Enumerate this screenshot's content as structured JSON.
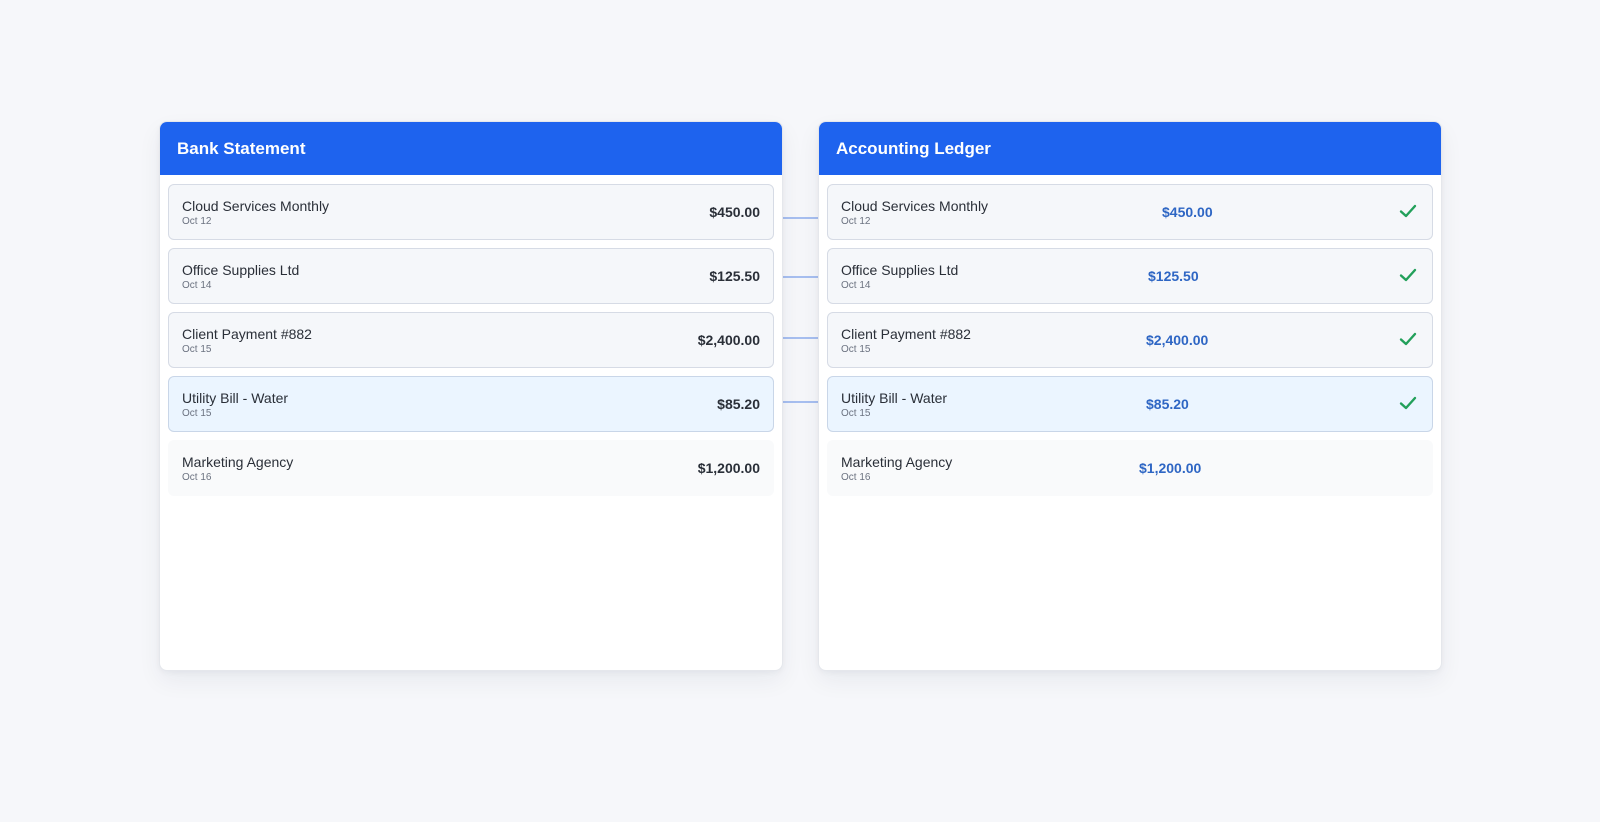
{
  "bank": {
    "title": "Bank Statement",
    "rows": [
      {
        "name": "Cloud Services Monthly",
        "date": "Oct 12",
        "amount": "$450.00"
      },
      {
        "name": "Office Supplies Ltd",
        "date": "Oct 14",
        "amount": "$125.50"
      },
      {
        "name": "Client Payment #882",
        "date": "Oct 15",
        "amount": "$2,400.00"
      },
      {
        "name": "Utility Bill - Water",
        "date": "Oct 15",
        "amount": "$85.20"
      },
      {
        "name": "Marketing Agency",
        "date": "Oct 16",
        "amount": "$1,200.00"
      }
    ]
  },
  "ledger": {
    "title": "Accounting Ledger",
    "rows": [
      {
        "name": "Cloud Services Monthly",
        "date": "Oct 12",
        "amount": "$450.00",
        "matched": true
      },
      {
        "name": "Office Supplies Ltd",
        "date": "Oct 14",
        "amount": "$125.50",
        "matched": true
      },
      {
        "name": "Client Payment #882",
        "date": "Oct 15",
        "amount": "$2,400.00",
        "matched": true
      },
      {
        "name": "Utility Bill - Water",
        "date": "Oct 15",
        "amount": "$85.20",
        "matched": true
      },
      {
        "name": "Marketing Agency",
        "date": "Oct 16",
        "amount": "$1,200.00",
        "matched": false
      }
    ]
  },
  "colors": {
    "header": "#1e63ee",
    "ledger_amount": "#2e66c4",
    "check": "#22a05a",
    "connector": "#a7bff0"
  }
}
